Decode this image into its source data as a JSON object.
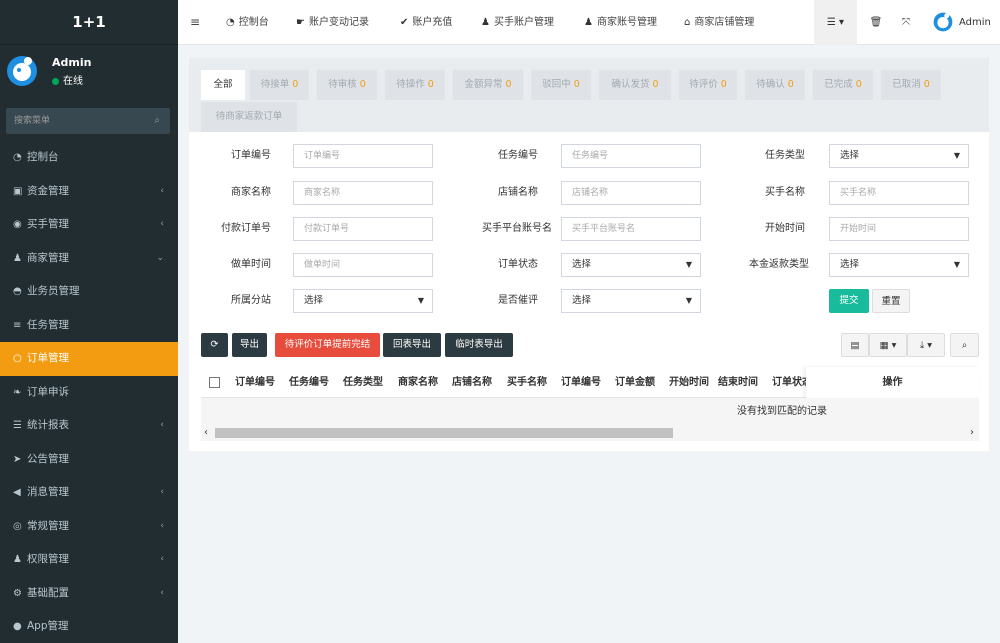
{
  "app": {
    "logo": "1+1"
  },
  "user": {
    "name": "Admin",
    "status": "在线"
  },
  "sidebar": {
    "search_placeholder": "搜索菜单",
    "items": [
      {
        "label": "控制台",
        "icon": "dashboard-icon",
        "arrow": ""
      },
      {
        "label": "资金管理",
        "icon": "money-icon",
        "arrow": "‹"
      },
      {
        "label": "买手管理",
        "icon": "user-circle-icon",
        "arrow": "‹"
      },
      {
        "label": "商家管理",
        "icon": "user-tie-icon",
        "arrow": "⌄"
      },
      {
        "label": "业务员管理",
        "icon": "user-secret-icon",
        "arrow": ""
      },
      {
        "label": "任务管理",
        "icon": "list-icon",
        "arrow": ""
      },
      {
        "label": "订单管理",
        "icon": "circle-icon",
        "arrow": ""
      },
      {
        "label": "订单申诉",
        "icon": "leaf-icon",
        "arrow": ""
      },
      {
        "label": "统计报表",
        "icon": "database-icon",
        "arrow": "‹"
      },
      {
        "label": "公告管理",
        "icon": "paper-plane-icon",
        "arrow": ""
      },
      {
        "label": "消息管理",
        "icon": "bullhorn-icon",
        "arrow": "‹"
      },
      {
        "label": "常规管理",
        "icon": "settings-icon",
        "arrow": "‹"
      },
      {
        "label": "权限管理",
        "icon": "group-icon",
        "arrow": "‹"
      },
      {
        "label": "基础配置",
        "icon": "cogs-icon",
        "arrow": "‹"
      },
      {
        "label": "App管理",
        "icon": "apple-icon",
        "arrow": ""
      }
    ]
  },
  "topbar": {
    "items": [
      "控制台",
      "账户变动记录",
      "账户充值",
      "买手账户管理",
      "商家账号管理",
      "商家店铺管理"
    ],
    "user": "Admin"
  },
  "tabs": [
    {
      "label": "全部",
      "count": ""
    },
    {
      "label": "待接单",
      "count": "0"
    },
    {
      "label": "待审核",
      "count": "0"
    },
    {
      "label": "待操作",
      "count": "0"
    },
    {
      "label": "金额异常",
      "count": "0"
    },
    {
      "label": "驳回中",
      "count": "0"
    },
    {
      "label": "确认发货",
      "count": "0"
    },
    {
      "label": "待评价",
      "count": "0"
    },
    {
      "label": "待确认",
      "count": "0"
    },
    {
      "label": "已完成",
      "count": "0"
    },
    {
      "label": "已取消",
      "count": "0"
    },
    {
      "label": "待商家返款订单",
      "count": ""
    }
  ],
  "form": {
    "order_no": {
      "label": "订单编号",
      "placeholder": "订单编号"
    },
    "task_no": {
      "label": "任务编号",
      "placeholder": "任务编号"
    },
    "task_type": {
      "label": "任务类型",
      "value": "选择"
    },
    "merchant": {
      "label": "商家名称",
      "placeholder": "商家名称"
    },
    "shop": {
      "label": "店铺名称",
      "placeholder": "店铺名称"
    },
    "buyer": {
      "label": "买手名称",
      "placeholder": "买手名称"
    },
    "pay_no": {
      "label": "付款订单号",
      "placeholder": "付款订单号"
    },
    "buyer_acc": {
      "label": "买手平台账号名",
      "placeholder": "买手平台账号名"
    },
    "start": {
      "label": "开始时间",
      "placeholder": "开始时间"
    },
    "order_time": {
      "label": "做单时间",
      "placeholder": "做单时间"
    },
    "order_status": {
      "label": "订单状态",
      "value": "选择"
    },
    "refund_type": {
      "label": "本金返款类型",
      "value": "选择"
    },
    "branch": {
      "label": "所属分站",
      "value": "选择"
    },
    "urge": {
      "label": "是否催评",
      "value": "选择"
    },
    "submit": "提交",
    "reset": "重置"
  },
  "toolbar": {
    "export": "导出",
    "finish": "待评价订单提前完结",
    "report_export": "回表导出",
    "temp_export": "临时表导出"
  },
  "table": {
    "headers": [
      "订单编号",
      "任务编号",
      "任务类型",
      "商家名称",
      "店铺名称",
      "买手名称",
      "订单编号",
      "订单金额",
      "开始时间",
      "结束时间",
      "订单状态"
    ],
    "ops": "操作",
    "empty": "没有找到匹配的记录"
  }
}
